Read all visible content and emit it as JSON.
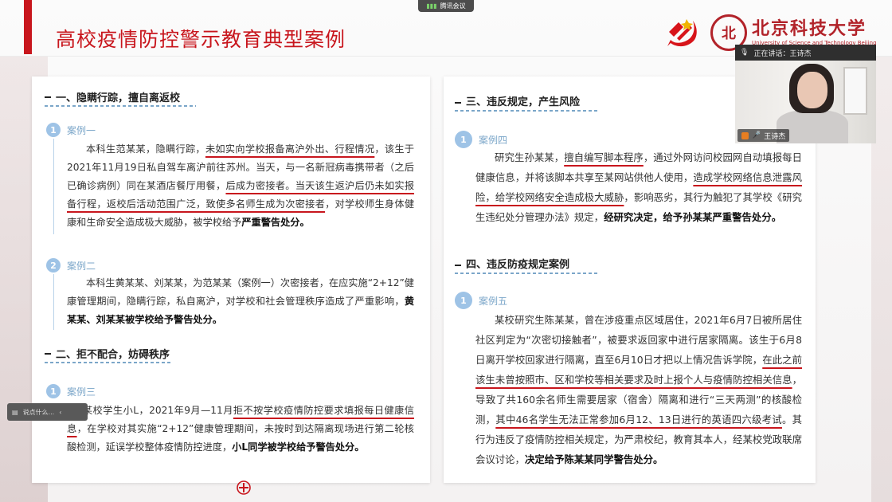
{
  "slide": {
    "title": "高校疫情防控警示教育典型案例",
    "university": {
      "seal_char": "北",
      "name_cn": "北京科技大学",
      "name_en": "University of Science and Technology Beijing"
    },
    "brand_red": "#c8161d",
    "accent_blue": "#9ec3e6"
  },
  "meeting": {
    "tab_label": "腾讯会议",
    "speaking_label": "正在讲话：王诗杰",
    "participant_name": "王诗杰",
    "chat_preview": "说点什么..."
  },
  "left": {
    "section1": "一、隐瞒行踪，擅自离返校",
    "case1": {
      "num": "1",
      "label": "案例一"
    },
    "case1_text": {
      "p1": "本科生范某某，隐瞒行踪，",
      "u1": "未如实向学校报备离沪外出、行程情况",
      "p2": "，该生于2021年11月19日私自驾车离沪前往苏州。当天，与一名新冠病毒携带者（之后已确诊病例）同在某酒店餐厅用餐，",
      "u2": "后成为密接者。当天该生返沪后仍未如实报备行程，返校后活动范围广泛，致使多名师生成为次密接者",
      "p3": "，对学校师生身体健康和生命安全造成极大威胁，被学校给予",
      "b1": "严重警告处分。"
    },
    "case2": {
      "num": "2",
      "label": "案例二"
    },
    "case2_text": {
      "p1": "本科生黄某某、刘某某，为范某某（案例一）次密接者，在应实施“2+12”健康管理期间，隐瞒行踪，私自离沪，对学校和社会管理秩序造成了严重影响，",
      "b1": "黄某某、刘某某被学校给予警告处分。"
    },
    "section2": "二、拒不配合，妨碍秩序",
    "case3": {
      "num": "1",
      "label": "案例三"
    },
    "case3_text": {
      "p1": "某校学生小L，2021年9月—11月",
      "u1": "拒不按学校疫情防控要求填报每日健康信息",
      "p2": "，在学校对其实施“2+12”健康管理期间，未按时到达隔离现场进行第二轮核酸检测，延误学校整体疫情防控进度，",
      "b1": "小L同学被学校给予警告处分。"
    }
  },
  "right": {
    "section3": "三、违反规定，产生风险",
    "case4": {
      "num": "1",
      "label": "案例四"
    },
    "case4_text": {
      "p1": "研究生孙某某，",
      "u1": "擅自编写脚本程序",
      "p2": "，通过外网访问校园网自动填报每日健康信息，并将该脚本共享至某网站供他人使用，",
      "u2": "造成学校网络信息泄露风险，给学校网络安全造成极大威胁",
      "p3": "，影响恶劣，其行为触犯了其学校《研究生违纪处分管理办法》规定，",
      "b1": "经研究决定，给予孙某某严重警告处分。"
    },
    "section4": "四、违反防疫规定案例",
    "case5": {
      "num": "1",
      "label": "案例五"
    },
    "case5_text": {
      "p1": "某校研究生陈某某，曾在涉疫重点区域居住，2021年6月7日被所居住社区判定为“次密切接触者”，被要求返回家中进行居家隔离。该生于6月8日离开学校回家进行隔离，直至6月10日才把以上情况告诉学院，",
      "u1": "在此之前该生未曾按照市、区和学校等相关要求及时上报个人与疫情防控相关信息",
      "p2": "，导致了共160余名师生需要居家（宿舍）隔离和进行“三天两测”的核酸检测，",
      "u2": "其中46名学生无法正常参加6月12、13日进行的英语四六级考试",
      "p3": "。其行为违反了疫情防控相关规定，为严肃校纪，教育其本人，经某校党政联席会议讨论，",
      "b1": "决定给予陈某某同学警告处分。"
    }
  }
}
